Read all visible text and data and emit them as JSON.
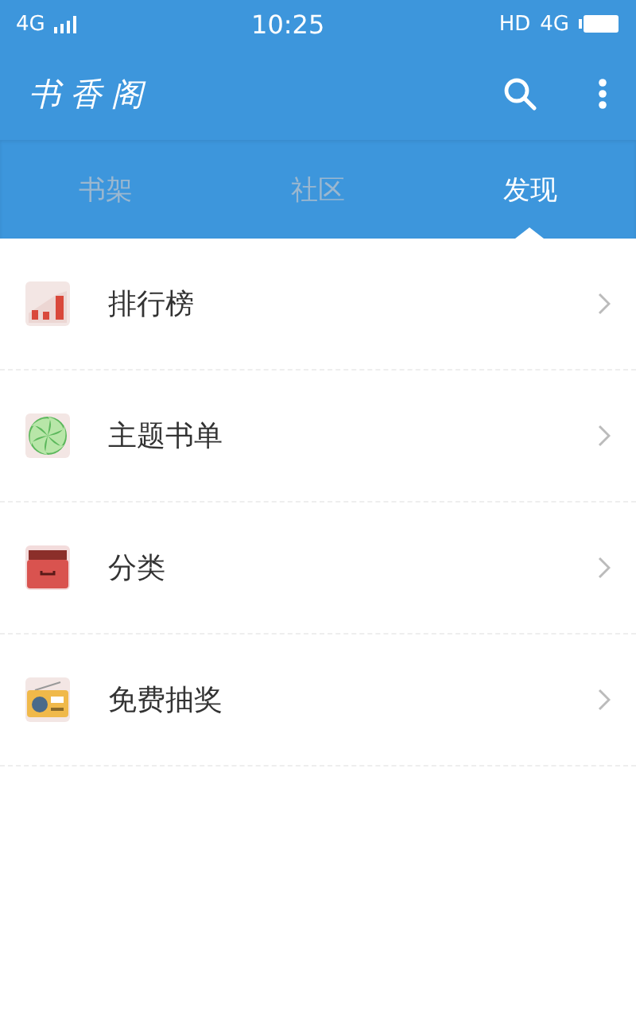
{
  "status_bar": {
    "network_left": "4G",
    "time": "10:25",
    "hd": "HD",
    "network_right": "4G"
  },
  "app_bar": {
    "logo": "书香阁"
  },
  "tabs": [
    {
      "label": "书架",
      "selected": false
    },
    {
      "label": "社区",
      "selected": false
    },
    {
      "label": "发现",
      "selected": true
    }
  ],
  "items": [
    {
      "label": "排行榜",
      "kind": "chart"
    },
    {
      "label": "主题书单",
      "kind": "candy"
    },
    {
      "label": "分类",
      "kind": "drawer"
    },
    {
      "label": "免费抽奖",
      "kind": "radio"
    }
  ]
}
